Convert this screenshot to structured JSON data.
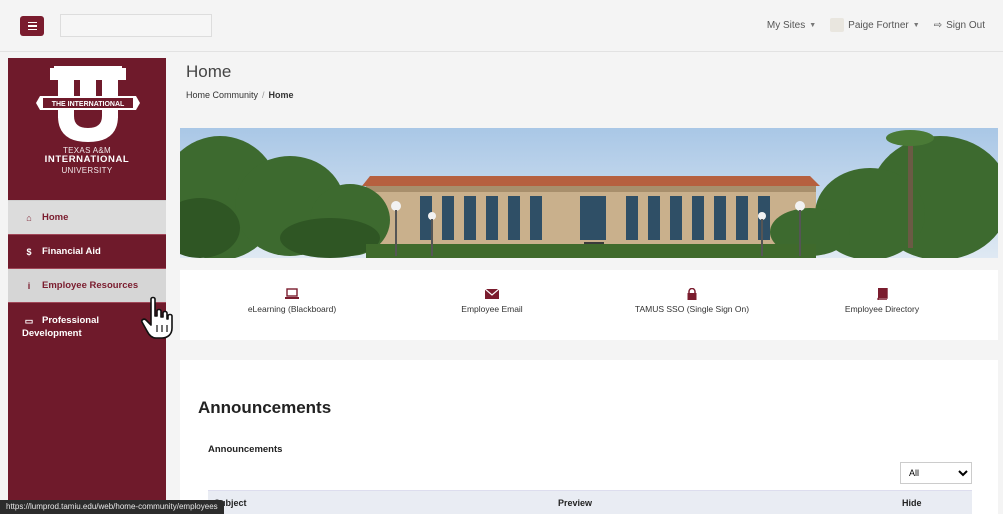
{
  "topbar": {
    "search_placeholder": "",
    "my_sites": "My Sites",
    "user_name": "Paige Fortner",
    "sign_out": "Sign Out"
  },
  "sidebar": {
    "logo": {
      "line1": "TEXAS A&M",
      "line2": "INTERNATIONAL",
      "line3": "UNIVERSITY",
      "seal_text": "THE INTERNATIONAL"
    },
    "items": [
      {
        "label": "Home",
        "icon": "home-icon"
      },
      {
        "label": "Financial Aid",
        "icon": "dollar-icon"
      },
      {
        "label": "Employee Resources",
        "icon": "info-icon"
      },
      {
        "label_line1": "Professional",
        "label_line2": "Development",
        "icon": "laptop-icon"
      }
    ]
  },
  "main": {
    "page_title": "Home",
    "breadcrumb": [
      {
        "label": "Home Community"
      },
      {
        "label": "Home"
      }
    ],
    "quick_links": [
      {
        "label": "eLearning (Blackboard)",
        "icon": "laptop-icon"
      },
      {
        "label": "Employee Email",
        "icon": "envelope-icon"
      },
      {
        "label": "TAMUS SSO (Single Sign On)",
        "icon": "lock-icon"
      },
      {
        "label": "Employee Directory",
        "icon": "book-icon"
      }
    ],
    "announcements": {
      "title": "Announcements",
      "subtitle": "Announcements",
      "filter_value": "All",
      "columns": [
        "Subject",
        "Preview",
        "Hide"
      ]
    }
  },
  "status_bar": {
    "url": "https://lumprod.tamiu.edu/web/home-community/employees"
  },
  "colors": {
    "brand": "#6f1a2b",
    "accent": "#7a1c2e",
    "nav_active_bg": "#dcdcdc",
    "table_head_bg": "#e9ecf3"
  }
}
